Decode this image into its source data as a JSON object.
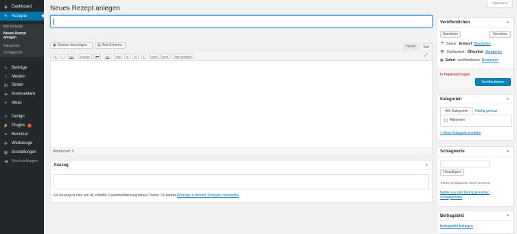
{
  "sidebar": {
    "dashboard": "Dashboard",
    "rezepte": "Rezepte",
    "submenu": {
      "all": "Alle Rezepte",
      "new_line1": "Neues Rezept",
      "new_line2": "anlegen",
      "kategorien": "Kategorien",
      "schlagworte": "Schlagworte"
    },
    "items": [
      {
        "label": "Beiträge",
        "icon": "pin"
      },
      {
        "label": "Medien",
        "icon": "media"
      },
      {
        "label": "Seiten",
        "icon": "page"
      },
      {
        "label": "Kommentare",
        "icon": "comment"
      },
      {
        "label": "Ideas",
        "icon": "lightbulb"
      },
      {
        "label": "Design",
        "icon": "brush"
      },
      {
        "label": "Plugins",
        "icon": "plug"
      },
      {
        "label": "Benutzer",
        "icon": "user"
      },
      {
        "label": "Werkzeuge",
        "icon": "wrench"
      },
      {
        "label": "Einstellungen",
        "icon": "settings"
      },
      {
        "label": "Menü einklappen",
        "icon": "collapse"
      }
    ],
    "plugins_badge": "1"
  },
  "page_title": "Neues Rezept anlegen",
  "screen_options": "Optionen ▾",
  "title_input_value": "",
  "media_buttons": {
    "add_files": "Dateien hinzufügen",
    "add_schema": "Add Schema"
  },
  "editor_tabs": {
    "visual": "Visuell",
    "text": "Text"
  },
  "quicktags": [
    "b",
    "i",
    "link",
    "b-quote",
    "del",
    "ins",
    "img",
    "ul",
    "ol",
    "li",
    "code",
    "more",
    "Tags schließen"
  ],
  "word_count": "Wortanzahl: 0",
  "excerpt": {
    "title": "Auszug",
    "help_prefix": "Ein Auszug ist eine von dir erstellte Zusammenfassung deines Textes. Du kannst ",
    "help_link": "Auszüge in deinem Template verwenden"
  },
  "publish": {
    "title": "Veröffentlichen",
    "save": "Speichern",
    "preview": "Vorschau",
    "status_label": "Status:",
    "status_value": "Entwurf",
    "visibility_label": "Sichtbarkeit:",
    "visibility_value": "Öffentlich",
    "schedule_prefix": "Sofort",
    "schedule_rest": "veröffentlichen",
    "edit": "Bearbeiten",
    "trash": "In Papierkorb legen",
    "publish_button": "Veröffentlichen"
  },
  "categories": {
    "title": "Kategorien",
    "tab_all": "Alle Kategorien",
    "tab_popular": "Häufig genutzt",
    "items": [
      "Allgemein"
    ],
    "add_link": "+ Neue Kategorie erstellen"
  },
  "tags": {
    "title": "Schlagworte",
    "input_value": "",
    "add_button": "Hinzufügen",
    "hint": "Trenne Schlagwörter durch Kommas",
    "choose_line1": "Wähle aus den häufig genutzten",
    "choose_line2": "Schlagwörtern"
  },
  "featured_image": {
    "title": "Beitragsbild",
    "link": "Beitragsbild festlegen"
  },
  "colors": {
    "sidebar_bg": "#23282d",
    "active": "#0073aa",
    "primary_button": "#0085ba",
    "badge": "#d54e21",
    "trash": "#a00"
  }
}
